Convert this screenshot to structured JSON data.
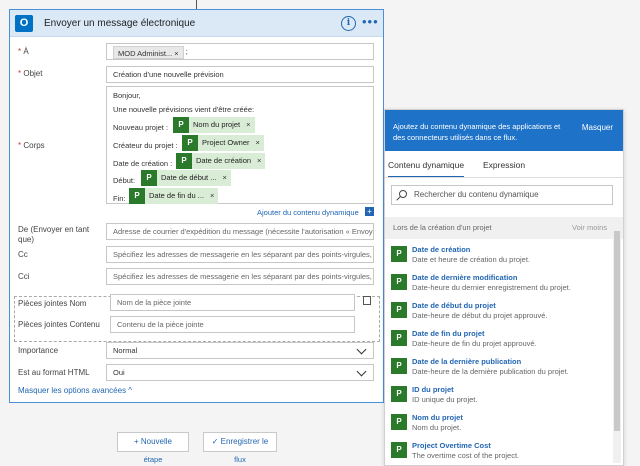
{
  "card": {
    "title": "Envoyer un message électronique",
    "logo": "O",
    "info_icon": "i",
    "more_icon": "•••",
    "to": {
      "label": "À",
      "token": "MOD Administ...",
      "token_remove": "×",
      "suffix": ";"
    },
    "subject": {
      "label": "Objet",
      "value": "Création d'une nouvelle prévision"
    },
    "body": {
      "label": "Corps",
      "line1": "Bonjour,",
      "line2": "Une nouvelle prévisions vient d'être créée:",
      "row1_label": "Nouveau projet :",
      "row1_token": "Nom du projet",
      "row2_label": "Créateur du projet :",
      "row2_token": "Project Owner",
      "row3_label": "Date de création :",
      "row3_token": "Date de création",
      "row4_label": "Début:",
      "row4_token": "Date de début ...",
      "row5_label": "Fin:",
      "row5_token": "Date de fin du ...",
      "token_remove": "×",
      "add_dynamic": "Ajouter du contenu dynamique",
      "add_icon": "+"
    },
    "from": {
      "label": "De (Envoyer en tant que)",
      "placeholder": "Adresse de courrier d'expédition du message (nécessite l'autorisation « Envoy"
    },
    "cc": {
      "label": "Cc",
      "placeholder": "Spécifiez les adresses de messagerie en les séparant par des points-virgules,"
    },
    "bcc": {
      "label": "Cci",
      "placeholder": "Spécifiez les adresses de messagerie en les séparant par des points-virgules,"
    },
    "attach_name": {
      "label": "Pièces jointes Nom",
      "placeholder": "Nom de la pièce jointe"
    },
    "attach_content": {
      "label": "Pièces jointes Contenu",
      "placeholder": "Contenu de la pièce jointe"
    },
    "importance": {
      "label": "Importance",
      "value": "Normal"
    },
    "html": {
      "label": "Est au format HTML",
      "value": "Oui"
    },
    "hide_advanced": "Masquer les options avancées"
  },
  "buttons": {
    "new_step": "+ Nouvelle",
    "new_step_2": "étape",
    "save": "✓ Enregistrer le",
    "save_2": "flux"
  },
  "panel": {
    "header_line1": "Ajoutez du contenu dynamique des applications et",
    "header_line2": "des connecteurs utilisés dans ce flux.",
    "hide": "Masquer",
    "tab_dynamic": "Contenu dynamique",
    "tab_expression": "Expression",
    "search_placeholder": "Rechercher du contenu dynamique",
    "section": "Lors de la création d'un projet",
    "see_less": "Voir moins",
    "items": [
      {
        "name": "Date de création",
        "desc": "Date et heure de création du projet."
      },
      {
        "name": "Date de dernière modification",
        "desc": "Date-heure du dernier enregistrement du projet."
      },
      {
        "name": "Date de début du projet",
        "desc": "Date-heure de début du projet approuvé."
      },
      {
        "name": "Date de fin du projet",
        "desc": "Date-heure de fin du projet approuvé."
      },
      {
        "name": "Date de la dernière publication",
        "desc": "Date-heure de la dernière publication du projet."
      },
      {
        "name": "ID du projet",
        "desc": "ID unique du projet."
      },
      {
        "name": "Nom du projet",
        "desc": "Nom du projet."
      },
      {
        "name": "Project Overtime Cost",
        "desc": "The overtime cost of the project."
      }
    ]
  }
}
